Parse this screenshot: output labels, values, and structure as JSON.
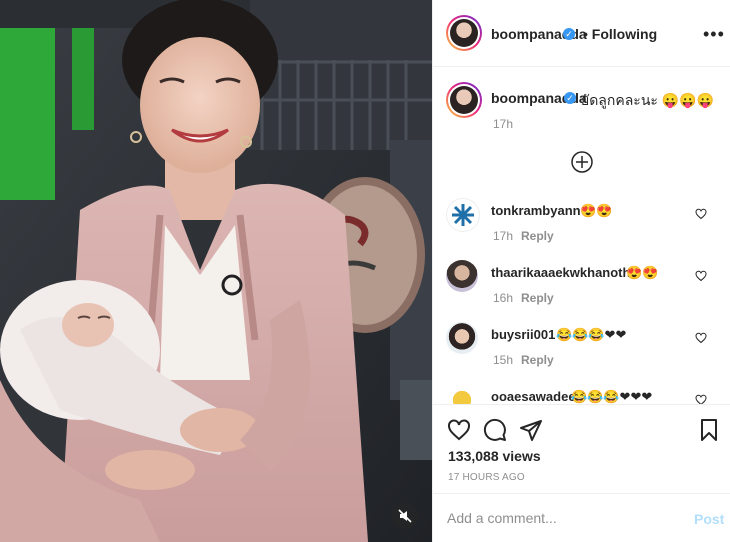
{
  "post": {
    "username": "boompanadda",
    "follow_status": "Following",
    "more_label": "•••",
    "caption": "ยัดลูกคละนะ 😛😛😛",
    "caption_time": "17h",
    "views": "133,088 views",
    "time_ago": "17 HOURS AGO"
  },
  "comments": [
    {
      "username": "tonkrambyann",
      "text": "😍😍",
      "time": "17h",
      "reply": "Reply"
    },
    {
      "username": "thaarikaaaekwkhanoth",
      "text": "😍😍",
      "time": "16h",
      "reply": "Reply"
    },
    {
      "username": "buysrii001",
      "text": "😂😂😂❤❤",
      "time": "15h",
      "reply": "Reply"
    },
    {
      "username": "ooaesawadee",
      "text": "😂😂😂❤❤❤",
      "time": "",
      "reply": ""
    }
  ],
  "add_comment": {
    "placeholder": "Add a comment...",
    "post_label": "Post"
  },
  "colors": {
    "verified": "#3897f0",
    "post_disabled": "#b2dffc",
    "secondary_text": "#8e8e8e",
    "jacket": "#d8b0ae"
  },
  "icons": [
    "verified-icon",
    "more-icon",
    "load-more-icon",
    "like-icon",
    "comment-icon",
    "share-icon",
    "save-icon",
    "mute-icon"
  ]
}
